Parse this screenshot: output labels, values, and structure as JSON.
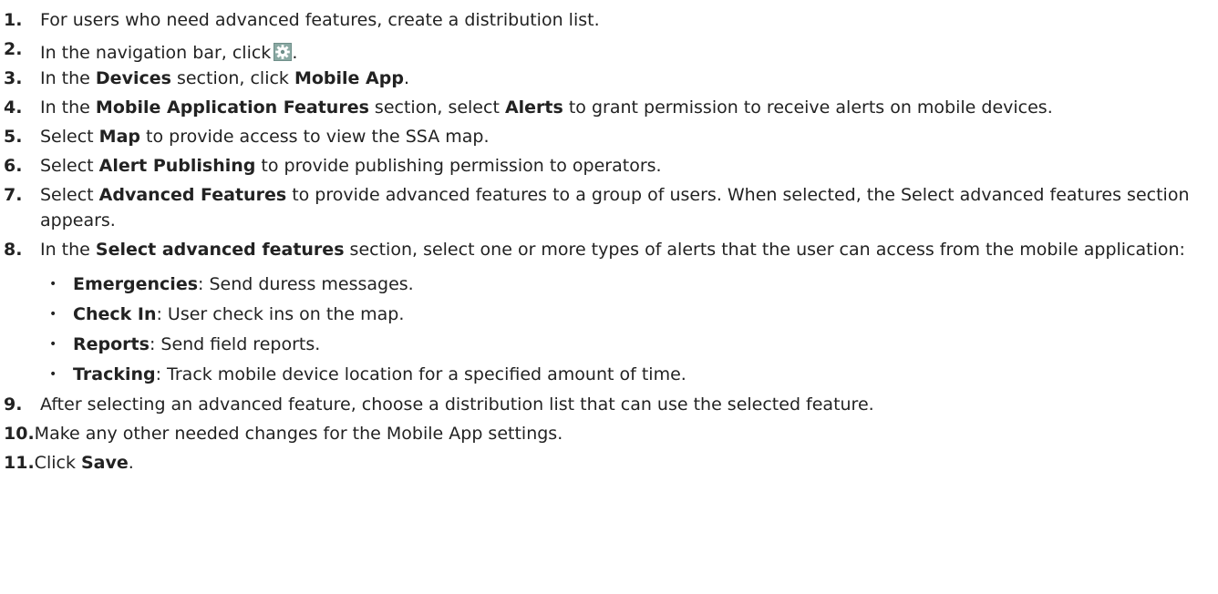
{
  "steps": [
    {
      "number": "1.",
      "parts": [
        "For users who need advanced features, create a distribution list."
      ]
    },
    {
      "number": "2.",
      "parts": [
        "In the navigation bar, click",
        "."
      ],
      "icon": "gear-icon"
    },
    {
      "number": "3.",
      "parts": [
        "In the ",
        "Devices",
        " section, click ",
        "Mobile App",
        "."
      ]
    },
    {
      "number": "4.",
      "parts": [
        "In the ",
        "Mobile Application Features",
        " section, select ",
        "Alerts",
        " to grant permission to receive alerts on mobile devices."
      ]
    },
    {
      "number": "5.",
      "parts": [
        "Select ",
        "Map",
        " to provide access to view the SSA map."
      ]
    },
    {
      "number": "6.",
      "parts": [
        "Select ",
        "Alert Publishing",
        " to provide publishing permission to operators."
      ]
    },
    {
      "number": "7.",
      "parts": [
        "Select ",
        "Advanced Features",
        " to provide advanced features to a group of users. When selected, the Select advanced features section appears."
      ]
    },
    {
      "number": "8.",
      "parts": [
        "In the ",
        "Select advanced features",
        " section, select one or more types of alerts that the user can access from the mobile application:"
      ]
    },
    {
      "number": "9.",
      "parts": [
        "After selecting an advanced feature, choose a distribution list that can use the selected feature."
      ]
    },
    {
      "number": "10.",
      "parts": [
        "Make any other needed changes for the Mobile App settings."
      ]
    },
    {
      "number": "11.",
      "parts": [
        "Click ",
        "Save",
        "."
      ]
    }
  ],
  "advanced_features": [
    {
      "bullet": "•",
      "term": "Emergencies",
      "desc": ": Send duress messages."
    },
    {
      "bullet": "•",
      "term": "Check In",
      "desc": ": User check ins on the map."
    },
    {
      "bullet": "•",
      "term": "Reports",
      "desc": ": Send field reports."
    },
    {
      "bullet": "•",
      "term": "Tracking",
      "desc": ": Track mobile device location for a specified amount of time."
    }
  ]
}
